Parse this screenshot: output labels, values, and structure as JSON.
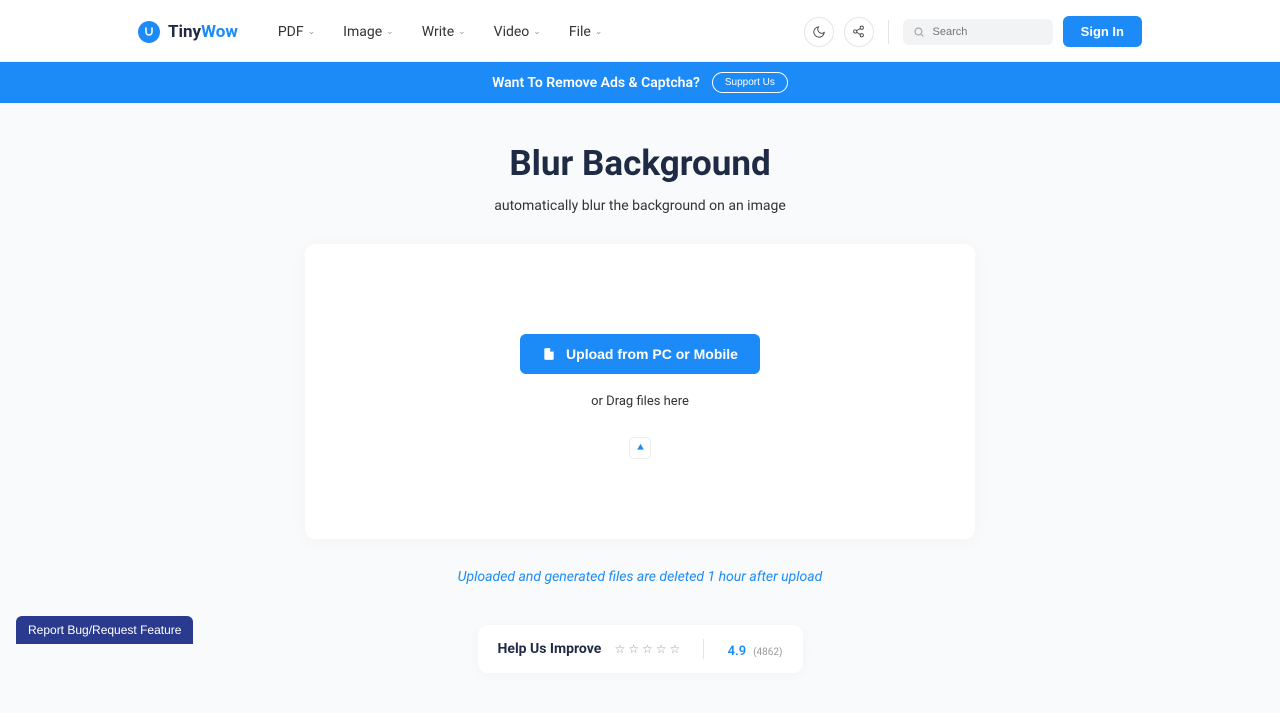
{
  "header": {
    "logo_tiny": "Tiny",
    "logo_wow": "Wow",
    "nav": [
      {
        "label": "PDF"
      },
      {
        "label": "Image"
      },
      {
        "label": "Write"
      },
      {
        "label": "Video"
      },
      {
        "label": "File"
      }
    ],
    "search_placeholder": "Search",
    "signin_label": "Sign In"
  },
  "banner": {
    "text": "Want To Remove Ads & Captcha?",
    "button": "Support Us"
  },
  "main": {
    "title": "Blur Background",
    "subtitle": "automatically blur the background on an image",
    "upload_button": "Upload from PC or Mobile",
    "drag_text": "or Drag files here",
    "disclaimer": "Uploaded and generated files are deleted 1 hour after upload"
  },
  "feedback": {
    "title": "Help Us Improve",
    "rating": "4.9",
    "count": "(4862)"
  },
  "report_label": "Report Bug/Request Feature"
}
